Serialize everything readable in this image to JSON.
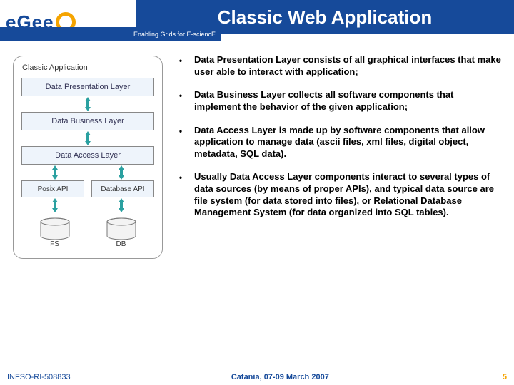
{
  "header": {
    "logo_text": "eGee",
    "tagline": "Enabling Grids for E-sciencE",
    "title": "Classic Web Application"
  },
  "diagram": {
    "title": "Classic Application",
    "layers": {
      "presentation": "Data Presentation Layer",
      "business": "Data Business Layer",
      "access": "Data Access Layer"
    },
    "apis": {
      "posix": "Posix API",
      "db": "Database API"
    },
    "stores": {
      "fs": "FS",
      "db": "DB"
    }
  },
  "bullets": [
    "Data Presentation Layer consists of all graphical interfaces that make user able to interact with application;",
    "Data Business Layer collects all software components that implement the behavior of the given application;",
    "Data Access Layer is made up by software components that allow application to manage data (ascii files, xml files, digital object, metadata, SQL data).",
    "Usually Data Access Layer components interact to several types of data sources (by means of proper APIs), and typical data source are file system (for data stored into files), or Relational Database Management System (for data organized into SQL tables)."
  ],
  "footer": {
    "left": "INFSO-RI-508833",
    "center": "Catania, 07-09 March 2007",
    "page": "5"
  }
}
